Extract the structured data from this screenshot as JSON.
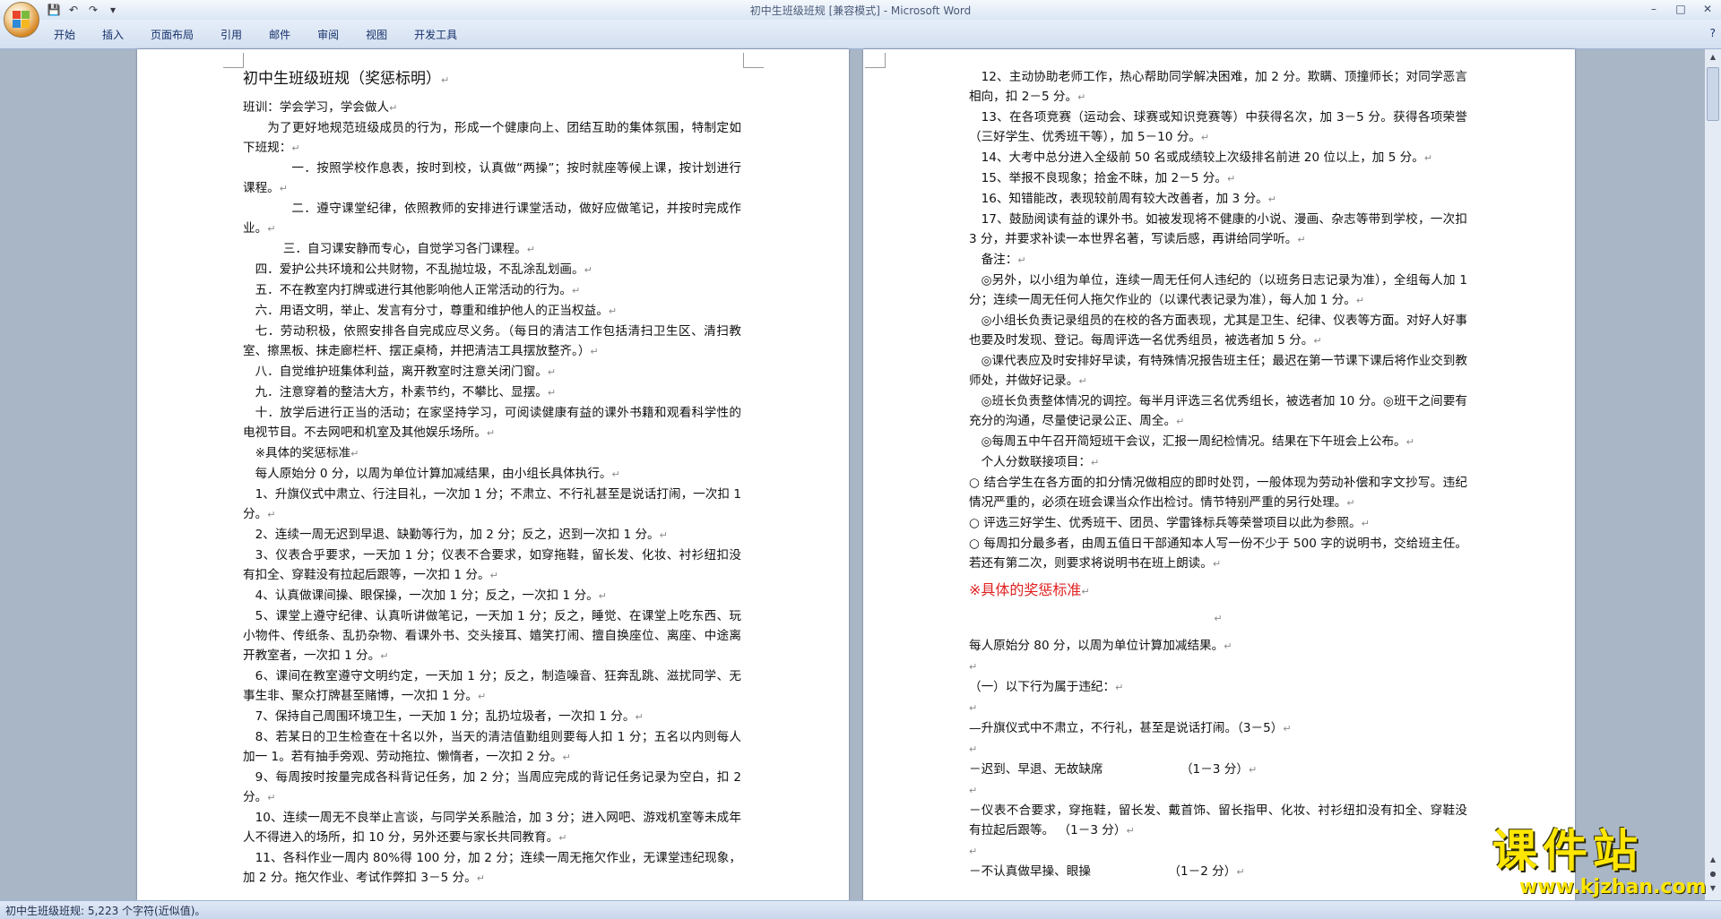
{
  "window": {
    "title": "初中生班级班规 [兼容模式] - Microsoft Word",
    "controls": [
      "–",
      "□",
      "✕"
    ]
  },
  "qat": {
    "save": "save-icon",
    "undo": "undo-icon",
    "redo": "redo-icon",
    "customize": "▾"
  },
  "ribbon": {
    "tabs": [
      "开始",
      "插入",
      "页面布局",
      "引用",
      "邮件",
      "审阅",
      "视图",
      "开发工具"
    ],
    "help": "?"
  },
  "page1": {
    "title": "初中生班级班规（奖惩标明）",
    "lines": [
      "班训：学会学习，学会做人",
      "为了更好地规范班级成员的行为，形成一个健康向上、团结互助的集体氛围，特制定如下班规：",
      "一．按照学校作息表，按时到校，认真做“两操”；按时就座等候上课，按计划进行课程。",
      "二．遵守课堂纪律，依照教师的安排进行课堂活动，做好应做笔记，并按时完成作业。",
      "三．自习课安静而专心，自觉学习各门课程。",
      "四．爱护公共环境和公共财物，不乱抛垃圾，不乱涂乱划画。",
      "五．不在教室内打牌或进行其他影响他人正常活动的行为。",
      "六．用语文明，举止、发言有分寸，尊重和维护他人的正当权益。",
      "七．劳动积极，依照安排各自完成应尽义务。（每日的清洁工作包括清扫卫生区、清扫教室、擦黑板、抹走廊栏杆、摆正桌椅，并把清洁工具摆放整齐。）",
      "八．自觉维护班集体利益，离开教室时注意关闭门窗。",
      "九．注意穿着的整洁大方，朴素节约，不攀比、显摆。",
      "十．放学后进行正当的活动；在家坚持学习，可阅读健康有益的课外书籍和观看科学性的电视节目。不去网吧和机室及其他娱乐场所。",
      "※具体的奖惩标准",
      "每人原始分 0 分，以周为单位计算加减结果，由小组长具体执行。",
      "1、升旗仪式中肃立、行注目礼，一次加 1 分；不肃立、不行礼甚至是说话打闹，一次扣 1 分。",
      "2、连续一周无迟到早退、缺勤等行为，加 2 分；反之，迟到一次扣 1 分。",
      "3、仪表合乎要求，一天加 1 分；仪表不合要求，如穿拖鞋，留长发、化妆、衬衫纽扣没有扣全、穿鞋没有拉起后跟等，一次扣 1 分。",
      "4、认真做课间操、眼保操，一次加 1 分；反之，一次扣 1 分。",
      "5、课堂上遵守纪律、认真听讲做笔记，一天加 1 分；反之，睡觉、在课堂上吃东西、玩小物件、传纸条、乱扔杂物、看课外书、交头接耳、嬉笑打闹、擅自换座位、离座、中途离开教室者，一次扣 1 分。",
      "6、课间在教室遵守文明约定，一天加 1 分；反之，制造噪音、狂奔乱跳、滋扰同学、无事生非、聚众打牌甚至赌博，一次扣 1 分。",
      "7、保持自己周围环境卫生，一天加 1 分；乱扔垃圾者，一次扣 1 分。",
      "8、若某日的卫生检查在十名以外，当天的清洁值勤组则要每人扣 1 分；五名以内则每人加一 1。若有抽手旁观、劳动拖拉、懒惰者，一次扣 2 分。",
      "9、每周按时按量完成各科背记任务，加 2 分；当周应完成的背记任务记录为空白，扣 2 分。",
      "10、连续一周无不良举止言谈，与同学关系融洽，加 3 分；进入网吧、游戏机室等未成年人不得进入的场所，扣 10 分，另外还要与家长共同教育。",
      "11、各科作业一周内 80%得 100 分，加 2 分；连续一周无拖欠作业，无课堂违纪现象，加 2 分。拖欠作业、考试作弊扣 3－5 分。"
    ]
  },
  "page2": {
    "lines": [
      "12、主动协助老师工作，热心帮助同学解决困难，加 2 分。欺瞒、顶撞师长；对同学恶言相向，扣 2－5 分。",
      "13、在各项竞赛（运动会、球赛或知识竞赛等）中获得名次，加 3－5 分。获得各项荣誉（三好学生、优秀班干等），加 5－10 分。",
      "14、大考中总分进入全级前 50 名或成绩较上次级排名前进 20 位以上，加 5 分。",
      "15、举报不良现象；拾金不昧，加 2－5 分。",
      "16、知错能改，表现较前周有较大改善者，加 3 分。",
      "17、鼓励阅读有益的课外书。如被发现将不健康的小说、漫画、杂志等带到学校，一次扣 3 分，并要求补读一本世界名著，写读后感，再讲给同学听。",
      "备注：",
      "◎另外，以小组为单位，连续一周无任何人违纪的（以班务日志记录为准），全组每人加 1 分；连续一周无任何人拖欠作业的（以课代表记录为准），每人加 1 分。",
      "◎小组长负责记录组员的在校的各方面表现，尤其是卫生、纪律、仪表等方面。对好人好事也要及时发现、登记。每周评选一名优秀组员，被选者加 5 分。",
      "◎课代表应及时安排好早读，有特殊情况报告班主任；最迟在第一节课下课后将作业交到教师处，并做好记录。",
      "◎班长负责整体情况的调控。每半月评选三名优秀组长，被选者加 10 分。◎班干之间要有充分的沟通，尽量使记录公正、周全。",
      "◎每周五中午召开简短班干会议，汇报一周纪检情况。结果在下午班会上公布。",
      "个人分数联接项目：",
      "○ 结合学生在各方面的扣分情况做相应的即时处罚，一般体现为劳动补偿和字文抄写。违纪情况严重的，必须在班会课当众作出检讨。情节特别严重的另行处理。",
      "○ 评选三好学生、优秀班干、团员、学雷锋标兵等荣誉项目以此为参照。",
      "○ 每周扣分最多者，由周五值日干部通知本人写一份不少于 500 字的说明书，交给班主任。若还有第二次，则要求将说明书在班上朗读。"
    ],
    "red_title": "※具体的奖惩标准",
    "lines2": [
      "每人原始分 80 分，以周为单位计算加减结果。",
      "（一）以下行为属于违纪：",
      "—升旗仪式中不肃立，不行礼，甚至是说话打闹。（3－5）",
      "－迟到、早退、无故缺席                    （1－3 分）",
      "－仪表不合要求，穿拖鞋，留长发、戴首饰、留长指甲、化妆、衬衫纽扣没有扣全、穿鞋没有拉起后跟等。        （1－3 分）",
      "－不认真做早操、眼操                    （1－2 分）"
    ]
  },
  "paragraph_mark": "↵",
  "status": {
    "text": "初中生班级班规: 5,223 个字符(近似值)。"
  },
  "watermark": {
    "main": "课件站",
    "url": "www.kjzhan.com"
  }
}
